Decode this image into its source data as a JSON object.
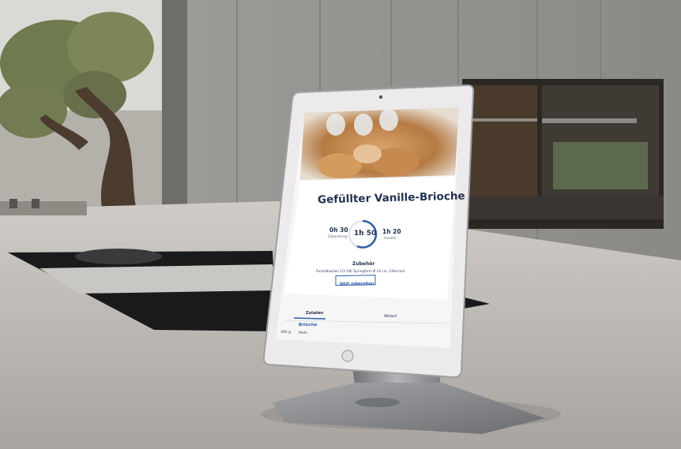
{
  "photo": {
    "description_icon": "tablet-on-stand-icon"
  },
  "recipe": {
    "title": "Gefüllter Vanille-Brioche",
    "prep_time": "0h 30",
    "prep_label": "Zubereitung",
    "center_time": "1h 50",
    "total_time": "1h 20",
    "total_label": "Gesamt",
    "accessories_heading": "Zubehör",
    "accessories_text": "Purzellbacken 1/2 GN, Springform Ø 24 cm, Gitterrost",
    "button_label": "Jetzt zubereiten",
    "tab_ingredients": "Zutaten",
    "tab_steps": "Ablauf",
    "section": "Brioche",
    "row_qty": "360 g",
    "row_name": "Mehl"
  },
  "colors": {
    "ui_text": "#23324f",
    "ui_accent": "#2f5fa8",
    "ui_background": "#f3f3f3"
  }
}
